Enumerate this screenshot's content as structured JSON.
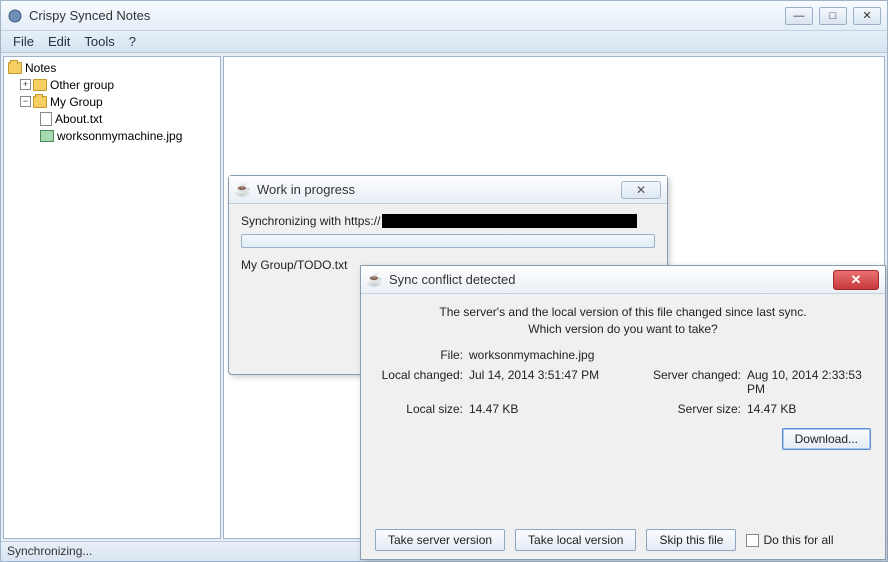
{
  "window": {
    "title": "Crispy Synced Notes"
  },
  "menu": {
    "file": "File",
    "edit": "Edit",
    "tools": "Tools",
    "help": "?"
  },
  "tree": {
    "root": "Notes",
    "other_group": "Other group",
    "my_group": "My Group",
    "about": "About.txt",
    "works": "worksonmymachine.jpg"
  },
  "status": "Synchronizing...",
  "progress_dialog": {
    "title": "Work in progress",
    "sync_prefix": "Synchronizing with https://",
    "current_file": "My Group/TODO.txt"
  },
  "conflict_dialog": {
    "title": "Sync conflict detected",
    "message_line1": "The server's and the local version of this file changed since last sync.",
    "message_line2": "Which version do you want to take?",
    "file_label": "File:",
    "file_value": "worksonmymachine.jpg",
    "local_changed_label": "Local changed:",
    "local_changed_value": "Jul 14, 2014 3:51:47 PM",
    "server_changed_label": "Server changed:",
    "server_changed_value": "Aug 10, 2014 2:33:53 PM",
    "local_size_label": "Local size:",
    "local_size_value": "14.47 KB",
    "server_size_label": "Server size:",
    "server_size_value": "14.47 KB",
    "download": "Download...",
    "take_server": "Take server version",
    "take_local": "Take local version",
    "skip": "Skip this file",
    "do_all": "Do this for all"
  }
}
